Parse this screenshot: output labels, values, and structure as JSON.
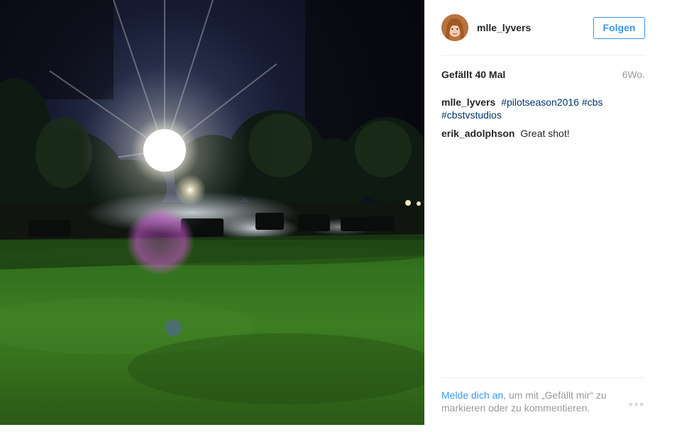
{
  "post": {
    "photo_alt": "",
    "author": {
      "username": "mlle_lyvers"
    },
    "follow_label": "Folgen",
    "likes": "Gefällt 40 Mal",
    "age": "6Wo.",
    "caption": {
      "user": "mlle_lyvers",
      "tags": [
        "#pilotseason2016",
        "#cbs",
        "#cbstvstudios"
      ]
    },
    "comments": [
      {
        "user": "erik_adolphson",
        "text": "Great shot!"
      }
    ],
    "login_prompt": {
      "link": "Melde dich an",
      "text": ", um mit „Gefällt mir“ zu markieren oder zu kommentieren."
    },
    "more_icon": "ellipsis-icon"
  },
  "colors": {
    "accent": "#3897f0",
    "hashtag": "#003569",
    "muted": "#999999",
    "text": "#262626"
  }
}
